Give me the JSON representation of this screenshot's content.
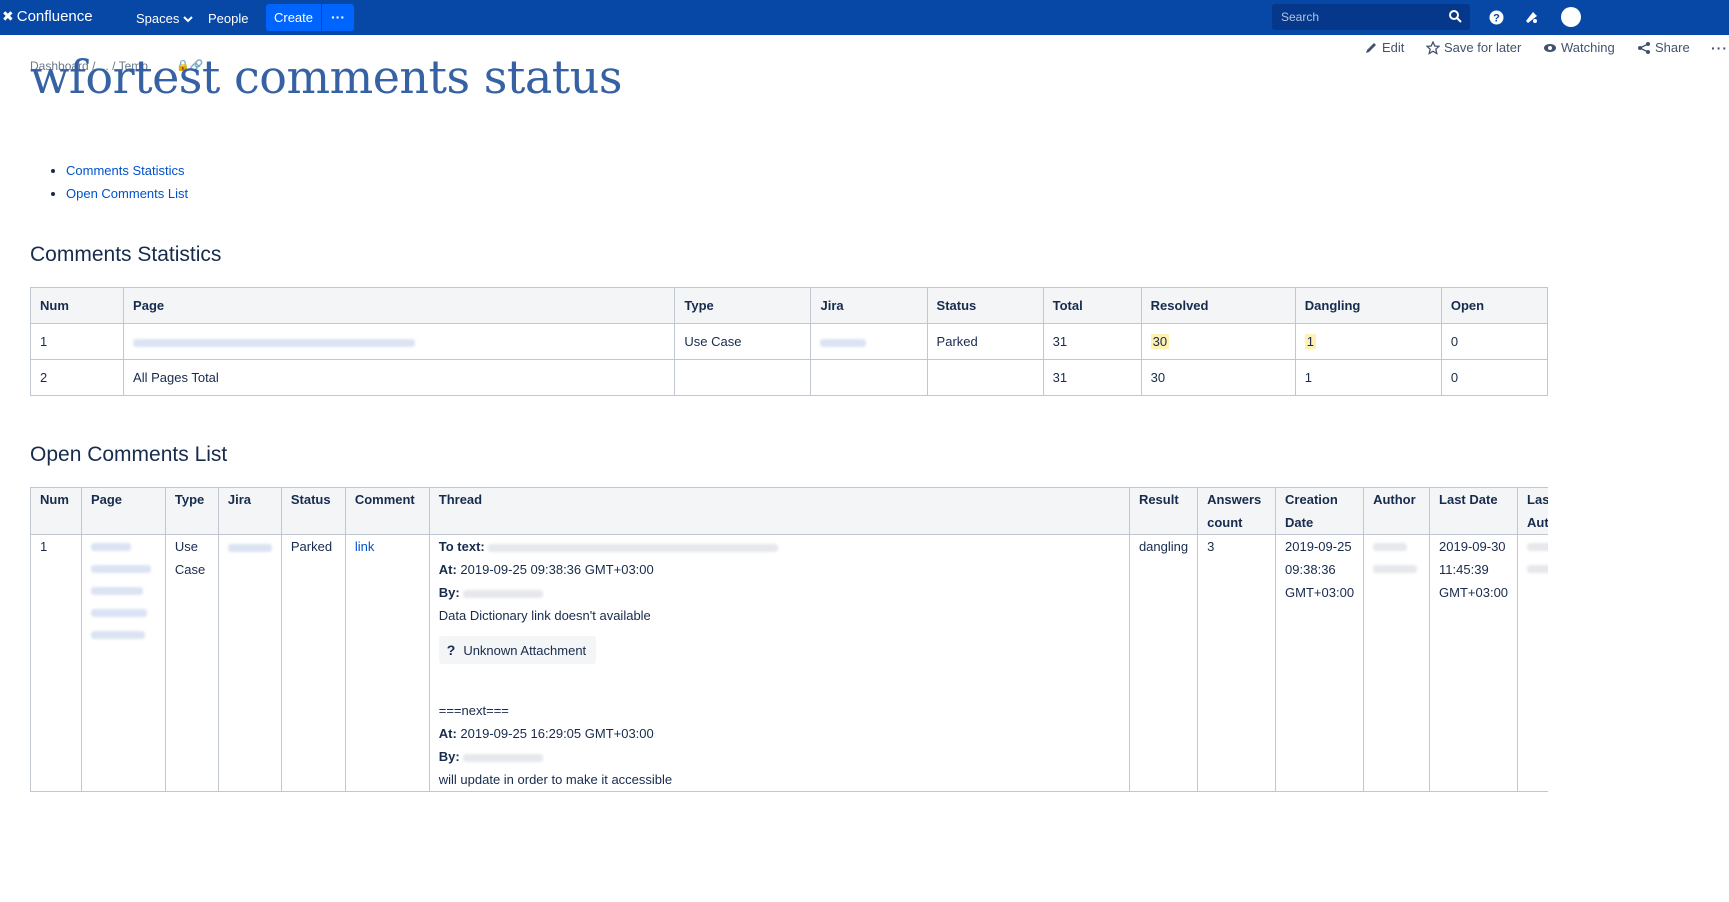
{
  "app": {
    "logo_text": "Confluence",
    "nav": {
      "spaces": "Spaces",
      "people": "People",
      "create": "Create",
      "more": "···"
    },
    "search": {
      "placeholder": "Search"
    }
  },
  "page_actions": {
    "edit": "Edit",
    "save_for_later": "Save for later",
    "watching": "Watching",
    "share": "Share",
    "more": "···"
  },
  "breadcrumb": [
    "Dashboard",
    "/",
    "...",
    "/",
    "Temp"
  ],
  "page_title": "wfortest comments status",
  "toc": [
    "Comments Statistics",
    "Open Comments List"
  ],
  "stats_section": {
    "heading": "Comments Statistics",
    "columns": [
      "Num",
      "Page",
      "Type",
      "Jira",
      "Status",
      "Total",
      "Resolved",
      "Dangling",
      "Open"
    ],
    "rows": [
      {
        "num": "1",
        "type": "Use Case",
        "status": "Parked",
        "total": "31",
        "resolved": "30",
        "dangling": "1",
        "open": "0"
      },
      {
        "num": "2",
        "page": "All Pages Total",
        "type": "",
        "status": "",
        "total": "31",
        "resolved": "30",
        "dangling": "1",
        "open": "0"
      }
    ]
  },
  "open_section": {
    "heading": "Open Comments List",
    "columns": [
      "Num",
      "Page",
      "Type",
      "Jira",
      "Status",
      "Comment",
      "Thread",
      "Result",
      "Answers count",
      "Creation Date",
      "Author",
      "Last Date",
      "Last Author"
    ],
    "rows": [
      {
        "num": "1",
        "type": "Use Case",
        "status": "Parked",
        "comment": "link",
        "thread": {
          "to_text_label": "To text:",
          "at_label": "At:",
          "by_label": "By:",
          "at1": "2019-09-25 09:38:36 GMT+03:00",
          "text1": "Data Dictionary link doesn't available",
          "attachment": "Unknown Attachment",
          "next": "===next===",
          "at2": "2019-09-25 16:29:05 GMT+03:00",
          "text2": "will update in order to make it accessible"
        },
        "result": "dangling",
        "answers_count": "3",
        "creation_date": "2019-09-25 09:38:36 GMT+03:00",
        "last_date": "2019-09-30 11:45:39 GMT+03:00"
      }
    ]
  },
  "colors": {
    "topbar": "#0747a6",
    "create": "#0065ff",
    "link": "#0052cc",
    "title": "#2c5aa0",
    "highlight": "#fff0b3"
  }
}
